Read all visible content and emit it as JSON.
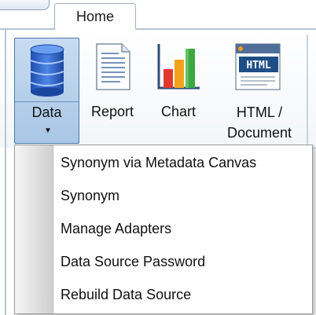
{
  "ribbon": {
    "tab_home": "Home",
    "buttons": {
      "data": "Data",
      "report": "Report",
      "chart": "Chart",
      "html_line1": "HTML /",
      "html_line2": "Document"
    }
  },
  "data_menu": {
    "items": [
      "Synonym via Metadata Canvas",
      "Synonym",
      "Manage Adapters",
      "Data Source Password",
      "Rebuild Data Source"
    ]
  },
  "icons": {
    "data": "database-icon",
    "report": "report-document-icon",
    "chart": "bar-chart-icon",
    "html": "html-document-icon",
    "dropdown": "dropdown-arrow-icon"
  }
}
